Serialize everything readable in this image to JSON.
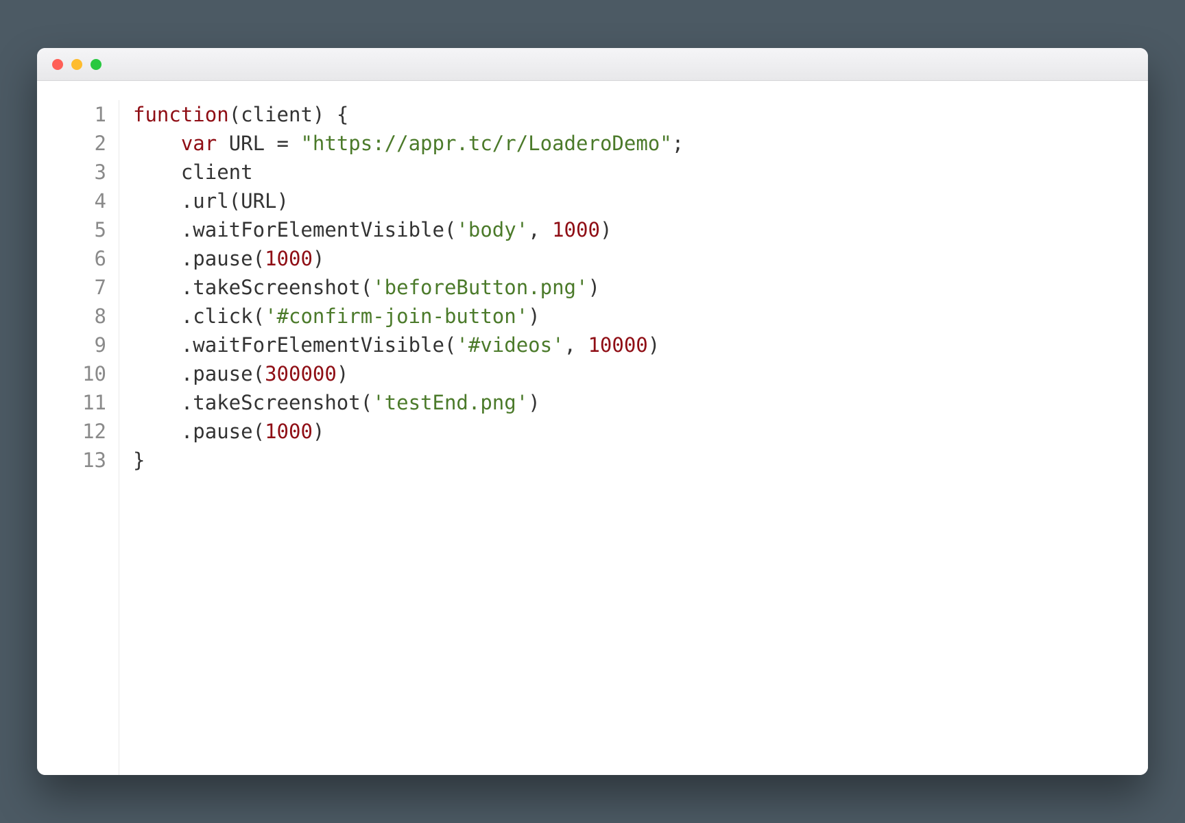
{
  "window": {
    "traffic_lights": {
      "red": "#ff5f57",
      "yellow": "#febc2e",
      "green": "#28c840"
    }
  },
  "code": {
    "line_count": 13,
    "lines": [
      {
        "n": 1,
        "tokens": [
          {
            "t": "function",
            "c": "kw"
          },
          {
            "t": "(client) {",
            "c": "punc"
          }
        ]
      },
      {
        "n": 2,
        "tokens": [
          {
            "t": "    ",
            "c": "punc"
          },
          {
            "t": "var",
            "c": "kw2"
          },
          {
            "t": " URL = ",
            "c": "ident"
          },
          {
            "t": "\"https://appr.tc/r/LoaderoDemo\"",
            "c": "str"
          },
          {
            "t": ";",
            "c": "punc"
          }
        ]
      },
      {
        "n": 3,
        "tokens": [
          {
            "t": "    client",
            "c": "ident"
          }
        ]
      },
      {
        "n": 4,
        "tokens": [
          {
            "t": "    .url(URL)",
            "c": "method"
          }
        ]
      },
      {
        "n": 5,
        "tokens": [
          {
            "t": "    .waitForElementVisible(",
            "c": "method"
          },
          {
            "t": "'body'",
            "c": "str"
          },
          {
            "t": ", ",
            "c": "punc"
          },
          {
            "t": "1000",
            "c": "num"
          },
          {
            "t": ")",
            "c": "punc"
          }
        ]
      },
      {
        "n": 6,
        "tokens": [
          {
            "t": "    .pause(",
            "c": "method"
          },
          {
            "t": "1000",
            "c": "num"
          },
          {
            "t": ")",
            "c": "punc"
          }
        ]
      },
      {
        "n": 7,
        "tokens": [
          {
            "t": "    .takeScreenshot(",
            "c": "method"
          },
          {
            "t": "'beforeButton.png'",
            "c": "str"
          },
          {
            "t": ")",
            "c": "punc"
          }
        ]
      },
      {
        "n": 8,
        "tokens": [
          {
            "t": "    .click(",
            "c": "method"
          },
          {
            "t": "'#confirm-join-button'",
            "c": "str"
          },
          {
            "t": ")",
            "c": "punc"
          }
        ]
      },
      {
        "n": 9,
        "tokens": [
          {
            "t": "    .waitForElementVisible(",
            "c": "method"
          },
          {
            "t": "'#videos'",
            "c": "str"
          },
          {
            "t": ", ",
            "c": "punc"
          },
          {
            "t": "10000",
            "c": "num"
          },
          {
            "t": ")",
            "c": "punc"
          }
        ]
      },
      {
        "n": 10,
        "tokens": [
          {
            "t": "    .pause(",
            "c": "method"
          },
          {
            "t": "300000",
            "c": "num"
          },
          {
            "t": ")",
            "c": "punc"
          }
        ]
      },
      {
        "n": 11,
        "tokens": [
          {
            "t": "    .takeScreenshot(",
            "c": "method"
          },
          {
            "t": "'testEnd.png'",
            "c": "str"
          },
          {
            "t": ")",
            "c": "punc"
          }
        ]
      },
      {
        "n": 12,
        "tokens": [
          {
            "t": "    .pause(",
            "c": "method"
          },
          {
            "t": "1000",
            "c": "num"
          },
          {
            "t": ")",
            "c": "punc"
          }
        ]
      },
      {
        "n": 13,
        "tokens": [
          {
            "t": "}",
            "c": "punc"
          }
        ]
      }
    ]
  }
}
